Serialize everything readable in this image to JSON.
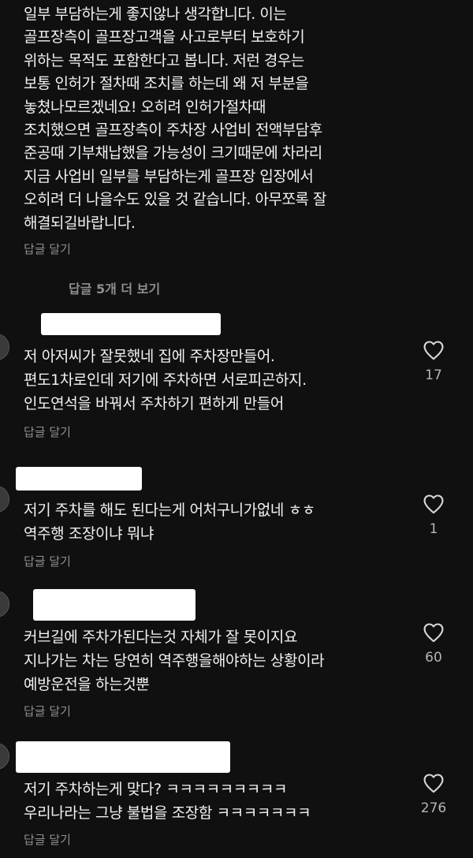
{
  "top_comment": {
    "text": "일부 부담하는게 좋지않나 생각합니다. 이는\n골프장측이 골프장고객을 사고로부터 보호하기\n위하는 목적도 포함한다고 봅니다. 저런 경우는\n보통 인허가 절차때 조치를 하는데 왜 저 부분을\n놓쳤나모르겠네요! 오히려 인허가절차때\n조치했으면 골프장측이 주차장 사업비 전액부담후\n준공때 기부채납했을 가능성이 크기때문에 차라리\n지금 사업비 일부를 부담하는게 골프장 입장에서\n오히려 더 나을수도 있을 것 같습니다. 아무쪼록 잘\n해결되길바랍니다.",
    "reply_label": "답글 달기"
  },
  "more_replies_label": "답글 5개 더 보기",
  "comments": [
    {
      "text": "저 아저씨가 잘못했네 집에 주차장만들어.\n편도1차로인데 저기에 주차하면 서로피곤하지.\n인도연석을 바꿔서 주차하기 편하게 만들어",
      "reply_label": "답글 달기",
      "likes": "17"
    },
    {
      "text": "저기 주차를 해도 된다는게 어처구니가없네 ㅎㅎ\n역주행 조장이냐 뭐냐",
      "reply_label": "답글 달기",
      "likes": "1"
    },
    {
      "text": "커브길에 주차가된다는것 자체가 잘 못이지요\n지나가는 차는 당연히 역주행을해야하는 상황이라\n예방운전을 하는것뿐",
      "reply_label": "답글 달기",
      "likes": "60"
    },
    {
      "text": "저기 주차하는게 맞다? ㅋㅋㅋㅋㅋㅋㅋㅋㅋ\n우리나라는 그냥 불법을 조장함 ㅋㅋㅋㅋㅋㅋㅋ",
      "reply_label": "답글 달기",
      "likes": "276"
    }
  ],
  "icons": {
    "like": "heart-outline-icon"
  },
  "colors": {
    "background": "#101010",
    "text": "#f2f2f2",
    "muted": "#8e8e8e",
    "redaction": "#ffffff"
  }
}
